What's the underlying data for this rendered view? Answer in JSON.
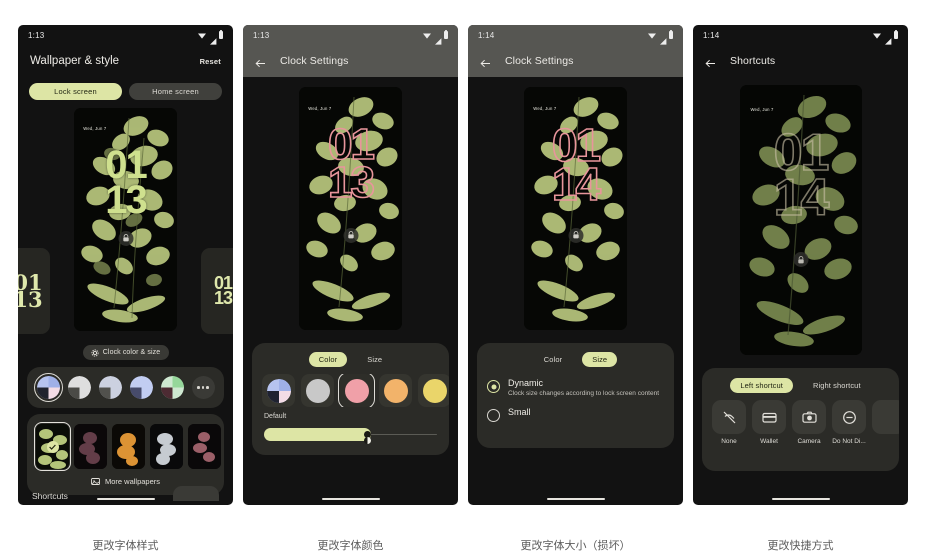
{
  "page": {
    "background": "#ffffff",
    "accent": "#dde5a5",
    "panel_bg": "#121212",
    "card_bg": "#2b2b27"
  },
  "panels": [
    {
      "id": "wallpaper-style",
      "caption": "更改字体样式",
      "status": {
        "time": "1:13",
        "icons": [
          "wifi-icon",
          "signal-icon",
          "battery-icon"
        ]
      },
      "appbar": {
        "style": "dark",
        "title": "Wallpaper & style",
        "action": "Reset",
        "back": false
      },
      "tabs": [
        {
          "label": "Lock screen",
          "selected": true
        },
        {
          "label": "Home screen",
          "selected": false
        }
      ],
      "preview": {
        "date": "Wed, Jun 7",
        "clock_top": "01",
        "clock_bottom": "13",
        "clock_color": "#d9e7a8"
      },
      "font_cards": [
        {
          "name": "serif-ornate-clock",
          "top": "01",
          "bottom": "13",
          "font": "serif"
        },
        {
          "name": "bold-sans-clock",
          "top": "01",
          "bottom": "13",
          "font": "sans"
        }
      ],
      "clock_button": {
        "label": "Clock color & size",
        "icon": "gear-icon"
      },
      "color_swatches": [
        {
          "name": "default-dynamic",
          "selected": true
        },
        {
          "name": "grey-white",
          "selected": false
        },
        {
          "name": "cool-grey",
          "selected": false
        },
        {
          "name": "periwinkle",
          "selected": false
        },
        {
          "name": "green-plum",
          "selected": false
        }
      ],
      "more_colors": "more-options-icon",
      "wallpapers": [
        {
          "name": "green-foxglove",
          "selected": true
        },
        {
          "name": "plum-bloom",
          "selected": false
        },
        {
          "name": "orange-bloom",
          "selected": false
        },
        {
          "name": "white-bloom",
          "selected": false
        },
        {
          "name": "pink-bloom",
          "selected": false
        }
      ],
      "more_wallpapers": {
        "label": "More wallpapers",
        "icon": "image-icon"
      },
      "shortcuts_peek": "Shortcuts"
    },
    {
      "id": "clock-settings-color",
      "caption": "更改字体颜色",
      "status": {
        "time": "1:13",
        "icons": [
          "wifi-icon",
          "signal-icon",
          "battery-icon"
        ]
      },
      "appbar": {
        "style": "grey",
        "title": "Clock Settings",
        "back": true
      },
      "preview": {
        "date": "Wed, Jun 7",
        "clock_top": "01",
        "clock_bottom": "13",
        "clock_color": "#e8959b"
      },
      "tabs": [
        {
          "label": "Color",
          "selected": true
        },
        {
          "label": "Size",
          "selected": false
        }
      ],
      "swatches": [
        {
          "name": "dynamic-default",
          "selected": false
        },
        {
          "name": "grey",
          "color": "#c8c8c8",
          "selected": false
        },
        {
          "name": "pink",
          "color": "#f0a0a8",
          "selected": true
        },
        {
          "name": "orange",
          "color": "#f2b36a",
          "selected": false
        },
        {
          "name": "yellow",
          "color": "#ead56a",
          "selected": false
        }
      ],
      "swatch_label": "Default",
      "slider": {
        "value": 62
      }
    },
    {
      "id": "clock-settings-size",
      "caption": "更改字体大小（损坏）",
      "status": {
        "time": "1:14",
        "icons": [
          "wifi-icon",
          "signal-icon",
          "battery-icon"
        ]
      },
      "appbar": {
        "style": "grey",
        "title": "Clock Settings",
        "back": true
      },
      "preview": {
        "date": "Wed, Jun 7",
        "clock_top": "01",
        "clock_bottom": "14",
        "clock_color": "#e8959b"
      },
      "tabs": [
        {
          "label": "Color",
          "selected": false
        },
        {
          "label": "Size",
          "selected": true
        }
      ],
      "options": [
        {
          "label": "Dynamic",
          "description": "Clock size changes according to lock screen content",
          "selected": true
        },
        {
          "label": "Small",
          "description": "",
          "selected": false
        }
      ]
    },
    {
      "id": "shortcuts",
      "caption": "更改快捷方式",
      "status": {
        "time": "1:14",
        "icons": [
          "wifi-icon",
          "signal-icon",
          "battery-icon"
        ]
      },
      "appbar": {
        "style": "dark",
        "title": "Shortcuts",
        "back": true
      },
      "preview": {
        "date": "Wed, Jun 7",
        "clock_top": "01",
        "clock_bottom": "14",
        "clock_color": "#b7b09a"
      },
      "tabs": [
        {
          "label": "Left shortcut",
          "selected": true
        },
        {
          "label": "Right shortcut",
          "selected": false
        }
      ],
      "shortcut_items": [
        {
          "label": "None",
          "icon": "no-shortcut-icon"
        },
        {
          "label": "Wallet",
          "icon": "wallet-icon"
        },
        {
          "label": "Camera",
          "icon": "camera-icon"
        },
        {
          "label": "Do Not Di...",
          "icon": "do-not-disturb-icon"
        }
      ]
    }
  ]
}
